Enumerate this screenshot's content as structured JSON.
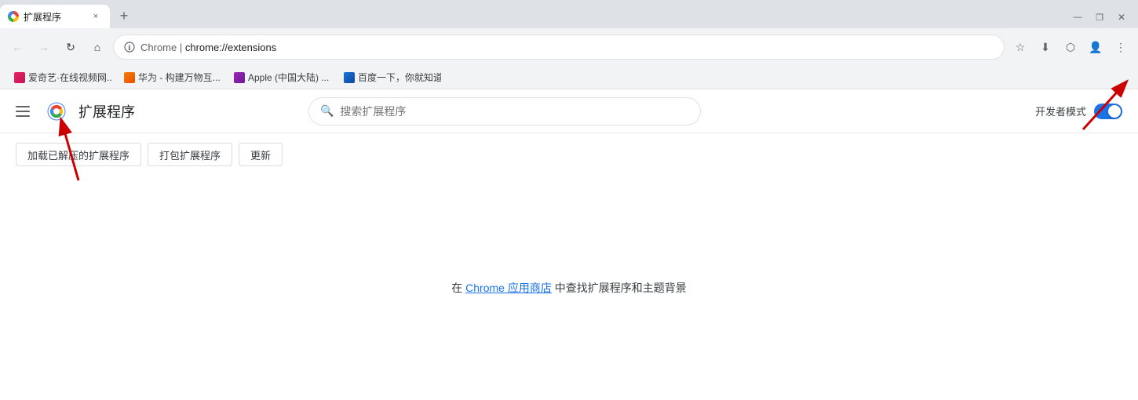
{
  "browser": {
    "tab": {
      "title": "扩展程序",
      "close_label": "×"
    },
    "new_tab_label": "+",
    "window_controls": {
      "minimize": "—",
      "maximize": "□",
      "restore": "❐",
      "close": "✕"
    },
    "address_bar": {
      "chrome_text": "Chrome",
      "separator": " | ",
      "url": "chrome://extensions"
    },
    "bookmarks": [
      {
        "label": "爱奇艺·在线视频网...",
        "color": "bm-color-1"
      },
      {
        "label": "华为 - 构建万物互...",
        "color": "bm-color-2"
      },
      {
        "label": "Apple (中国大陆) ...",
        "color": "bm-color-3"
      },
      {
        "label": "百度一下，你就知道",
        "color": "bm-color-4"
      }
    ]
  },
  "extensions_page": {
    "title": "扩展程序",
    "search_placeholder": "搜索扩展程序",
    "dev_mode_label": "开发者模式",
    "buttons": {
      "load_unpacked": "加载已解压的扩展程序",
      "pack": "打包扩展程序",
      "update": "更新"
    },
    "store_text_before": "在",
    "store_link": "Chrome 应用商店",
    "store_text_after": "中查找扩展程序和主题背景"
  },
  "icons": {
    "menu": "menu-icon",
    "search": "🔍",
    "back": "←",
    "forward": "→",
    "reload": "↻",
    "home": "⌂",
    "bookmark": "☆",
    "download": "⬇",
    "extensions": "⬡",
    "profile": "👤",
    "more": "⋮"
  }
}
